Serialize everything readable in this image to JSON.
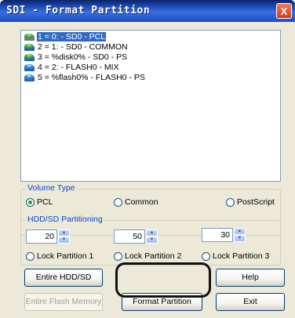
{
  "window": {
    "title": "SDI - Format Partition",
    "close_glyph": "X"
  },
  "partition_list": {
    "items": [
      {
        "label": "1 = 0: - SD0 - PCL",
        "icon": "drive-icon",
        "selected": true
      },
      {
        "label": "2 = 1: - SD0 - COMMON",
        "icon": "drive-icon",
        "selected": false
      },
      {
        "label": "3 = %disk0% - SD0 - PS",
        "icon": "drive-icon",
        "selected": false
      },
      {
        "label": "4 = 2: - FLASH0 - MIX",
        "icon": "flash-icon",
        "selected": false
      },
      {
        "label": "5 = %flash0% - FLASH0 - PS",
        "icon": "flash-icon",
        "selected": false
      }
    ]
  },
  "volume_type": {
    "title": "Volume Type",
    "options": [
      {
        "label": "PCL",
        "checked": true
      },
      {
        "label": "Common",
        "checked": false
      },
      {
        "label": "PostScript",
        "checked": false
      }
    ]
  },
  "partitioning": {
    "title": "HDD/SD Partitioning",
    "values": [
      "20",
      "50",
      "30"
    ],
    "locks": [
      {
        "label": "Lock Partition 1"
      },
      {
        "label": "Lock Partition 2"
      },
      {
        "label": "Lock Partition 3"
      }
    ]
  },
  "buttons": {
    "entire_hdd": "Entire HDD/SD",
    "entire_flash": "Entire Flash Memory",
    "format_partition": "Format Partition",
    "help": "Help",
    "exit": "Exit"
  },
  "colors": {
    "title_bar": "#2a5fd6",
    "selection": "#316ac5",
    "group_title": "#0046d5"
  }
}
